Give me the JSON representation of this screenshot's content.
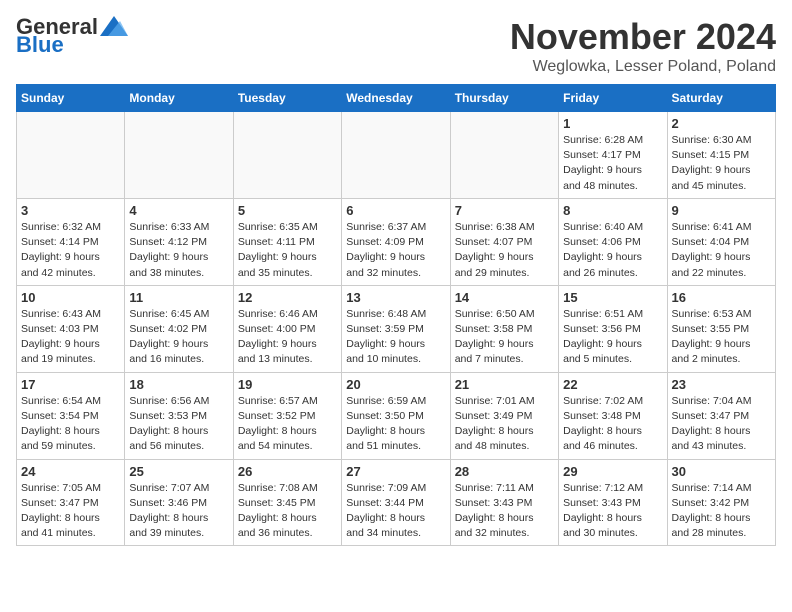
{
  "logo": {
    "line1": "General",
    "line2": "Blue"
  },
  "title": "November 2024",
  "location": "Weglowka, Lesser Poland, Poland",
  "weekdays": [
    "Sunday",
    "Monday",
    "Tuesday",
    "Wednesday",
    "Thursday",
    "Friday",
    "Saturday"
  ],
  "weeks": [
    [
      {
        "day": "",
        "info": ""
      },
      {
        "day": "",
        "info": ""
      },
      {
        "day": "",
        "info": ""
      },
      {
        "day": "",
        "info": ""
      },
      {
        "day": "",
        "info": ""
      },
      {
        "day": "1",
        "info": "Sunrise: 6:28 AM\nSunset: 4:17 PM\nDaylight: 9 hours\nand 48 minutes."
      },
      {
        "day": "2",
        "info": "Sunrise: 6:30 AM\nSunset: 4:15 PM\nDaylight: 9 hours\nand 45 minutes."
      }
    ],
    [
      {
        "day": "3",
        "info": "Sunrise: 6:32 AM\nSunset: 4:14 PM\nDaylight: 9 hours\nand 42 minutes."
      },
      {
        "day": "4",
        "info": "Sunrise: 6:33 AM\nSunset: 4:12 PM\nDaylight: 9 hours\nand 38 minutes."
      },
      {
        "day": "5",
        "info": "Sunrise: 6:35 AM\nSunset: 4:11 PM\nDaylight: 9 hours\nand 35 minutes."
      },
      {
        "day": "6",
        "info": "Sunrise: 6:37 AM\nSunset: 4:09 PM\nDaylight: 9 hours\nand 32 minutes."
      },
      {
        "day": "7",
        "info": "Sunrise: 6:38 AM\nSunset: 4:07 PM\nDaylight: 9 hours\nand 29 minutes."
      },
      {
        "day": "8",
        "info": "Sunrise: 6:40 AM\nSunset: 4:06 PM\nDaylight: 9 hours\nand 26 minutes."
      },
      {
        "day": "9",
        "info": "Sunrise: 6:41 AM\nSunset: 4:04 PM\nDaylight: 9 hours\nand 22 minutes."
      }
    ],
    [
      {
        "day": "10",
        "info": "Sunrise: 6:43 AM\nSunset: 4:03 PM\nDaylight: 9 hours\nand 19 minutes."
      },
      {
        "day": "11",
        "info": "Sunrise: 6:45 AM\nSunset: 4:02 PM\nDaylight: 9 hours\nand 16 minutes."
      },
      {
        "day": "12",
        "info": "Sunrise: 6:46 AM\nSunset: 4:00 PM\nDaylight: 9 hours\nand 13 minutes."
      },
      {
        "day": "13",
        "info": "Sunrise: 6:48 AM\nSunset: 3:59 PM\nDaylight: 9 hours\nand 10 minutes."
      },
      {
        "day": "14",
        "info": "Sunrise: 6:50 AM\nSunset: 3:58 PM\nDaylight: 9 hours\nand 7 minutes."
      },
      {
        "day": "15",
        "info": "Sunrise: 6:51 AM\nSunset: 3:56 PM\nDaylight: 9 hours\nand 5 minutes."
      },
      {
        "day": "16",
        "info": "Sunrise: 6:53 AM\nSunset: 3:55 PM\nDaylight: 9 hours\nand 2 minutes."
      }
    ],
    [
      {
        "day": "17",
        "info": "Sunrise: 6:54 AM\nSunset: 3:54 PM\nDaylight: 8 hours\nand 59 minutes."
      },
      {
        "day": "18",
        "info": "Sunrise: 6:56 AM\nSunset: 3:53 PM\nDaylight: 8 hours\nand 56 minutes."
      },
      {
        "day": "19",
        "info": "Sunrise: 6:57 AM\nSunset: 3:52 PM\nDaylight: 8 hours\nand 54 minutes."
      },
      {
        "day": "20",
        "info": "Sunrise: 6:59 AM\nSunset: 3:50 PM\nDaylight: 8 hours\nand 51 minutes."
      },
      {
        "day": "21",
        "info": "Sunrise: 7:01 AM\nSunset: 3:49 PM\nDaylight: 8 hours\nand 48 minutes."
      },
      {
        "day": "22",
        "info": "Sunrise: 7:02 AM\nSunset: 3:48 PM\nDaylight: 8 hours\nand 46 minutes."
      },
      {
        "day": "23",
        "info": "Sunrise: 7:04 AM\nSunset: 3:47 PM\nDaylight: 8 hours\nand 43 minutes."
      }
    ],
    [
      {
        "day": "24",
        "info": "Sunrise: 7:05 AM\nSunset: 3:47 PM\nDaylight: 8 hours\nand 41 minutes."
      },
      {
        "day": "25",
        "info": "Sunrise: 7:07 AM\nSunset: 3:46 PM\nDaylight: 8 hours\nand 39 minutes."
      },
      {
        "day": "26",
        "info": "Sunrise: 7:08 AM\nSunset: 3:45 PM\nDaylight: 8 hours\nand 36 minutes."
      },
      {
        "day": "27",
        "info": "Sunrise: 7:09 AM\nSunset: 3:44 PM\nDaylight: 8 hours\nand 34 minutes."
      },
      {
        "day": "28",
        "info": "Sunrise: 7:11 AM\nSunset: 3:43 PM\nDaylight: 8 hours\nand 32 minutes."
      },
      {
        "day": "29",
        "info": "Sunrise: 7:12 AM\nSunset: 3:43 PM\nDaylight: 8 hours\nand 30 minutes."
      },
      {
        "day": "30",
        "info": "Sunrise: 7:14 AM\nSunset: 3:42 PM\nDaylight: 8 hours\nand 28 minutes."
      }
    ]
  ]
}
